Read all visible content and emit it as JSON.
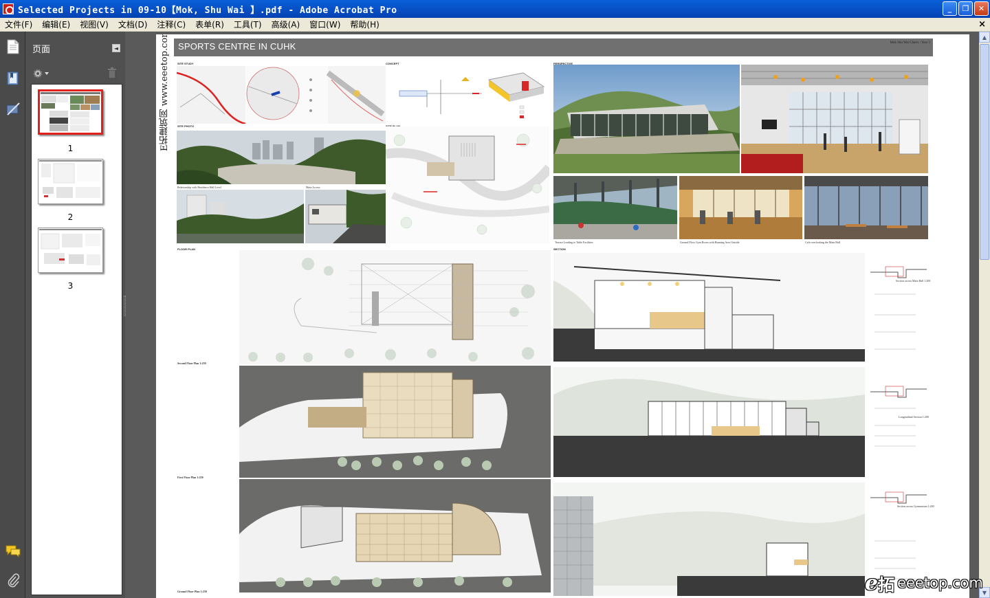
{
  "window": {
    "title": "Selected Projects in 09-10【Mok, Shu Wai 】.pdf - Adobe Acrobat Pro",
    "buttons": {
      "minimize": "_",
      "restore": "❐",
      "close": "✕"
    }
  },
  "menu": {
    "items": [
      "文件(F)",
      "编辑(E)",
      "视图(V)",
      "文档(D)",
      "注释(C)",
      "表单(R)",
      "工具(T)",
      "高级(A)",
      "窗口(W)",
      "帮助(H)"
    ],
    "doc_close": "×"
  },
  "pages_panel": {
    "title": "页面",
    "thumbnails": [
      {
        "number": "1",
        "selected": true
      },
      {
        "number": "2",
        "selected": false
      },
      {
        "number": "3",
        "selected": false
      }
    ]
  },
  "document": {
    "vertical_watermark": "E拓建筑网 www.eeetop.com",
    "poster_title": "SPORTS CENTRE IN CUHK",
    "poster_meta": [
      "Mok Shu Wai Charis / Year 3"
    ],
    "section_labels": {
      "site_study": "SITE STUDY",
      "concept": "CONCEPT",
      "perspective": "PERSPECTIVE",
      "site_photo": "SITE PHOTO",
      "site_plan": "SITE PLAN",
      "floor_plan": "FLOOR PLAN",
      "section": "SECTION"
    },
    "captions": {
      "second_floor": "Second Floor Plan 1:250",
      "first_floor": "First Floor Plan 1:250",
      "ground_floor": "Ground Floor Plan 1:250",
      "site_photo_1": "Relationship with Residence Hall Level",
      "site_photo_2": "Main Access",
      "persp_1": "Terrace Leading to Table Facilities",
      "persp_2": "Ground Floor Gym Room with Running Area Outside",
      "persp_3": "Cafe overlooking the Main Hall",
      "section_a": "Section across Main Hall 1:200",
      "section_b": "Longitudinal Section 1:200",
      "section_c": "Section across Gymnasium 1:200"
    }
  },
  "site_logo": {
    "e": "e",
    "tuo": "拓",
    "text": "eeetop.com"
  },
  "colors": {
    "titlebar": "#0442b3",
    "menubar": "#ece9d8",
    "panel_bg": "#505050",
    "selected_thumb": "#e0201b",
    "poster_title_bar": "#707070"
  }
}
